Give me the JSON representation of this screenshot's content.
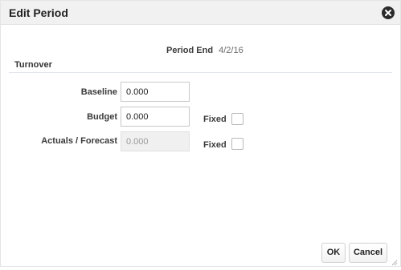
{
  "dialog": {
    "title": "Edit Period",
    "close_icon": "close-circle-icon"
  },
  "period_end": {
    "label": "Period End",
    "value": "4/2/16"
  },
  "section": {
    "title": "Turnover"
  },
  "fields": {
    "baseline": {
      "label": "Baseline",
      "value": "0.000"
    },
    "budget": {
      "label": "Budget",
      "value": "0.000",
      "fixed_label": "Fixed",
      "fixed_checked": false
    },
    "actuals_forecast": {
      "label": "Actuals / Forecast",
      "value": "0.000",
      "disabled": true,
      "fixed_label": "Fixed",
      "fixed_checked": false
    }
  },
  "buttons": {
    "ok": "OK",
    "cancel": "Cancel"
  }
}
